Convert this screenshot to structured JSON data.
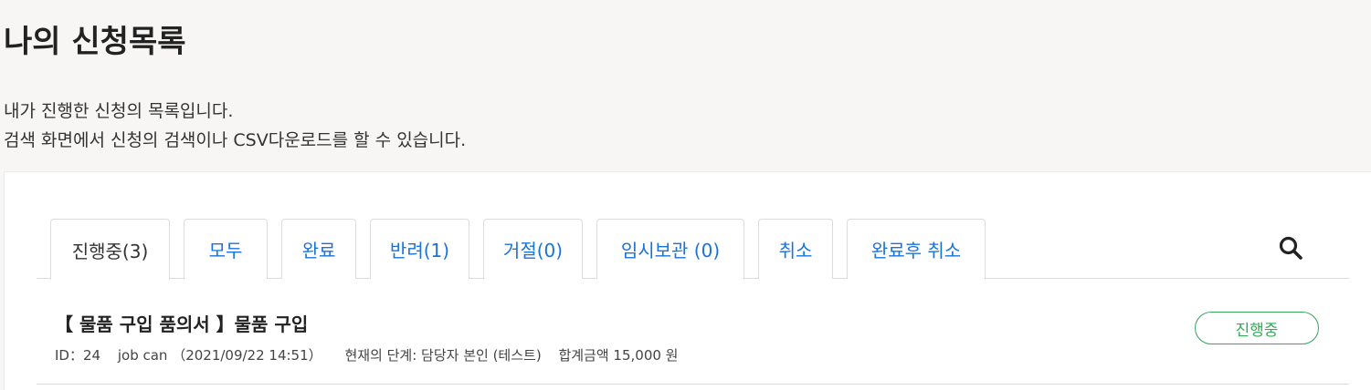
{
  "page": {
    "title": "나의 신청목록",
    "description_line1": "내가 진행한 신청의 목록입니다.",
    "description_line2": "검색 화면에서 신청의 검색이나 CSV다운로드를 할 수 있습니다."
  },
  "tabs": [
    {
      "label": "진행중(3)",
      "active": true
    },
    {
      "label": "모두",
      "active": false
    },
    {
      "label": "완료",
      "active": false
    },
    {
      "label": "반려(1)",
      "active": false
    },
    {
      "label": "거절(0)",
      "active": false
    },
    {
      "label": "임시보관 (0)",
      "active": false
    },
    {
      "label": "취소",
      "active": false
    },
    {
      "label": "완료후 취소",
      "active": false
    }
  ],
  "search": {
    "icon": "search-icon"
  },
  "requests": [
    {
      "title": "【 물품 구입 품의서 】물품 구입",
      "id": "ID：24",
      "applicant": "job can （2021/09/22 14:51）",
      "stage": "현재의 단계: 담당자 본인 (테스트)",
      "total": "합계금액 15,000 원",
      "status": "진행중"
    }
  ],
  "colors": {
    "link": "#1a73d8",
    "status_green": "#37a75a",
    "background": "#f7f6f4"
  }
}
